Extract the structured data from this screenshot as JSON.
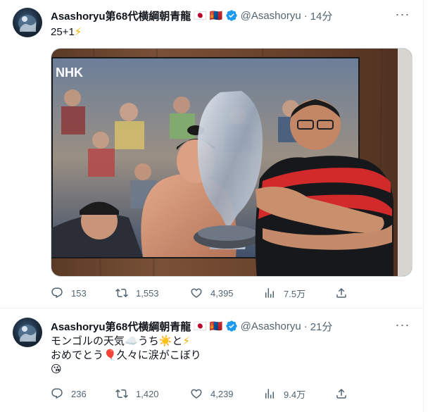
{
  "tweets": [
    {
      "name": "Asashoryu第68代横綱朝青龍",
      "flag_jp": "🇯🇵",
      "flag_mn": "🇲🇳",
      "handle": "@Asashoryu",
      "dot": "·",
      "time": "14分",
      "text_line1_main": "25+1",
      "text_line1_emoji": "⚡",
      "stats": {
        "replies": "153",
        "retweets": "1,553",
        "likes": "4,395",
        "views": "7.5万"
      },
      "media": {
        "nhk_logo": "NHK"
      }
    },
    {
      "name": "Asashoryu第68代横綱朝青龍",
      "flag_jp": "🇯🇵",
      "flag_mn": "🇲🇳",
      "handle": "@Asashoryu",
      "dot": "·",
      "time": "21分",
      "line1_a": "モンゴルの天気",
      "line1_cloud": "☁️",
      "line1_b": "うち",
      "line1_sun": "☀️",
      "line1_c": "と",
      "line1_bolt": "⚡",
      "line2_a": "おめでとう",
      "line2_balloon": "🎈",
      "line2_b": "久々に涙がこぼり",
      "line3_emoji": "😘",
      "stats": {
        "replies": "236",
        "retweets": "1,420",
        "likes": "4,239",
        "views": "9.4万"
      }
    }
  ],
  "icons": {
    "more": "more-icon",
    "reply": "reply-icon",
    "retweet": "retweet-icon",
    "like": "heart-icon",
    "views": "views-icon",
    "share": "share-icon",
    "verified": "verified-badge-icon"
  },
  "colors": {
    "verified": "#1d9bf0",
    "secondary_text": "#536471",
    "divider": "#eff3f4"
  },
  "more_glyph": "···"
}
